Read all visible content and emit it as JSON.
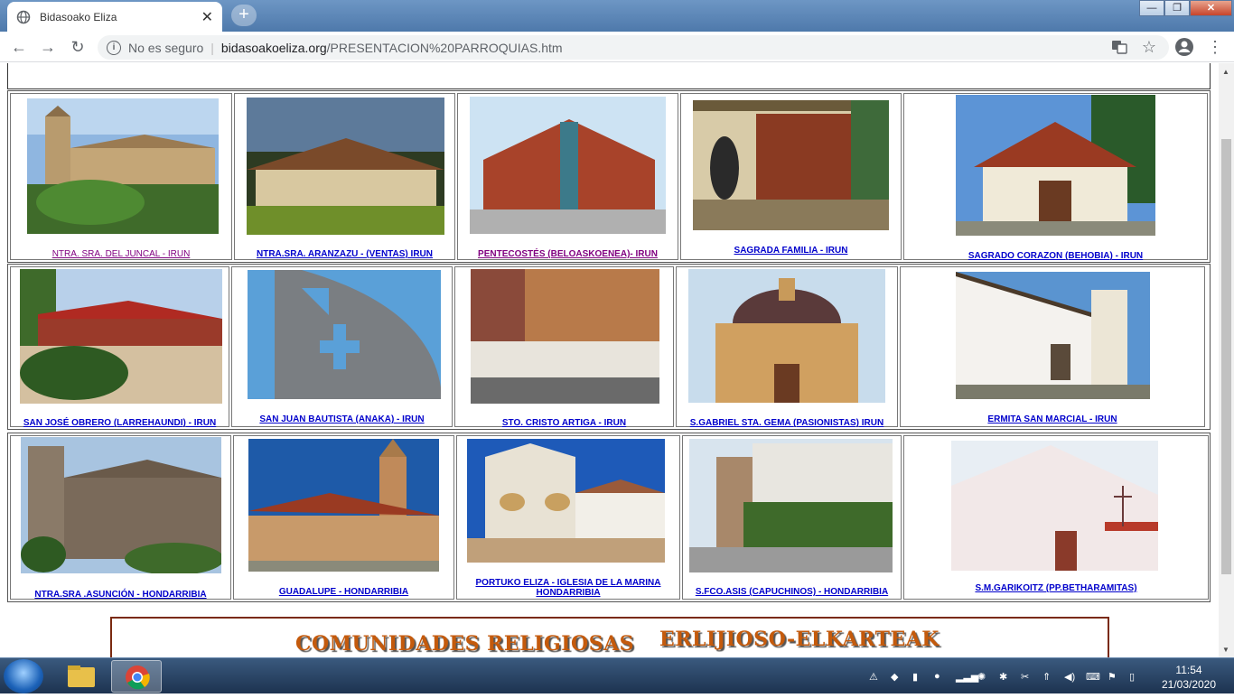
{
  "browser": {
    "tab_title": "Bidasoako Eliza",
    "tab_close": "✕",
    "new_tab": "+",
    "security_label": "No es seguro",
    "url_host": "bidasoakoeliza.org",
    "url_path": "/PRESENTACION%20PARROQUIAS.htm"
  },
  "window_controls": {
    "minimize": "—",
    "maximize": "❐",
    "close": "✕"
  },
  "parishes": [
    [
      {
        "label": "NTRA. SRA. DEL JUNCAL - IRUN",
        "visited": true
      },
      {
        "label": "NTRA.SRA. ARANZAZU - (VENTAS) IRUN",
        "visited": false
      },
      {
        "label": "PENTECOSTÉS  (BELOASKOENEA)- IRUN",
        "visited": true
      },
      {
        "label": "SAGRADA FAMILIA - IRUN",
        "visited": false
      },
      {
        "label": "SAGRADO CORAZON (BEHOBIA) - IRUN",
        "visited": false
      }
    ],
    [
      {
        "label": "SAN JOSÉ OBRERO (LARREHAUNDI) - IRUN",
        "visited": false
      },
      {
        "label": "SAN JUAN BAUTISTA (ANAKA) - IRUN",
        "visited": false
      },
      {
        "label": "STO. CRISTO ARTIGA - IRUN",
        "visited": false
      },
      {
        "label": "S.GABRIEL STA. GEMA (PASIONISTAS) IRUN",
        "visited": false
      },
      {
        "label": "ERMITA SAN MARCIAL - IRUN",
        "visited": false
      }
    ],
    [
      {
        "label": "NTRA.SRA .ASUNCIÓN - HONDARRIBIA",
        "visited": false
      },
      {
        "label": "GUADALUPE - HONDARRIBIA",
        "visited": false
      },
      {
        "label": "PORTUKO ELIZA - IGLESIA DE LA MARINA HONDARRIBIA",
        "visited": false
      },
      {
        "label": "S.FCO.ASIS (CAPUCHINOS) - HONDARRIBIA",
        "visited": false
      },
      {
        "label": "S.M.GARIKOITZ (PP.BETHARAMITAS)",
        "visited": false
      }
    ]
  ],
  "banner": {
    "left_text": "COMUNIDADES RELIGIOSAS",
    "right_text": "ERLIJIOSO-ELKARTEAK"
  },
  "taskbar": {
    "time": "11:54",
    "date": "21/03/2020"
  }
}
